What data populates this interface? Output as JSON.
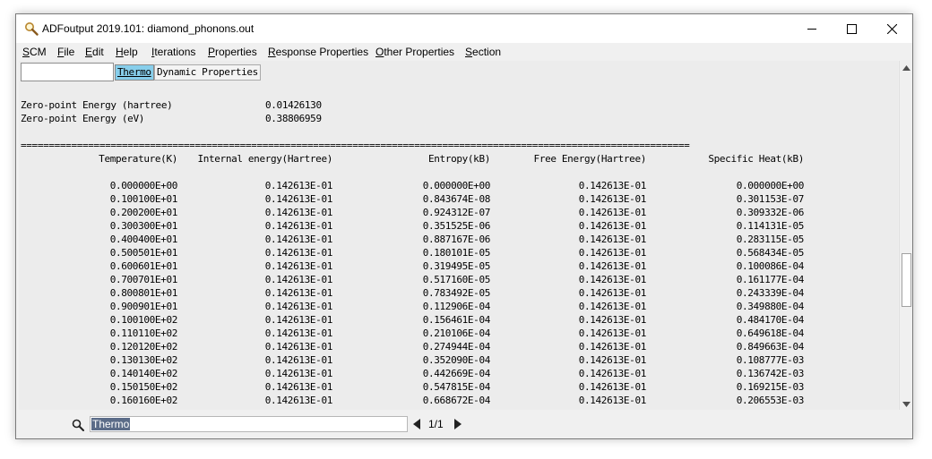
{
  "window": {
    "title": "ADFoutput 2019.101: diamond_phonons.out"
  },
  "menu": [
    {
      "label": "SCM",
      "underline": "S"
    },
    {
      "label": "File",
      "underline": "F"
    },
    {
      "label": "Edit",
      "underline": "E"
    },
    {
      "label": "Help",
      "underline": "H"
    },
    {
      "label": "Iterations",
      "underline": "I"
    },
    {
      "label": "Properties",
      "underline": "P"
    },
    {
      "label": "Response Properties",
      "underline": "R"
    },
    {
      "label": "Other Properties",
      "underline": "O"
    },
    {
      "label": "Section",
      "underline": "S"
    }
  ],
  "tabs": {
    "thermo": "Thermo",
    "dynamic": "Dynamic Properties"
  },
  "zpe": [
    {
      "label": "Zero-point Energy (hartree)",
      "value": "0.01426130"
    },
    {
      "label": "Zero-point Energy (eV)",
      "value": "0.38806959"
    }
  ],
  "separator": "=======================================================================================================================",
  "table": {
    "headers": [
      "Temperature(K)",
      "Internal energy(Hartree)",
      "Entropy(kB)",
      "Free Energy(Hartree)",
      "Specific Heat(kB)"
    ],
    "rows": [
      [
        "0.000000E+00",
        "0.142613E-01",
        "0.000000E+00",
        "0.142613E-01",
        "0.000000E+00"
      ],
      [
        "0.100100E+01",
        "0.142613E-01",
        "0.843674E-08",
        "0.142613E-01",
        "0.301153E-07"
      ],
      [
        "0.200200E+01",
        "0.142613E-01",
        "0.924312E-07",
        "0.142613E-01",
        "0.309332E-06"
      ],
      [
        "0.300300E+01",
        "0.142613E-01",
        "0.351525E-06",
        "0.142613E-01",
        "0.114131E-05"
      ],
      [
        "0.400400E+01",
        "0.142613E-01",
        "0.887167E-06",
        "0.142613E-01",
        "0.283115E-05"
      ],
      [
        "0.500501E+01",
        "0.142613E-01",
        "0.180101E-05",
        "0.142613E-01",
        "0.568434E-05"
      ],
      [
        "0.600601E+01",
        "0.142613E-01",
        "0.319495E-05",
        "0.142613E-01",
        "0.100086E-04"
      ],
      [
        "0.700701E+01",
        "0.142613E-01",
        "0.517160E-05",
        "0.142613E-01",
        "0.161177E-04"
      ],
      [
        "0.800801E+01",
        "0.142613E-01",
        "0.783492E-05",
        "0.142613E-01",
        "0.243339E-04"
      ],
      [
        "0.900901E+01",
        "0.142613E-01",
        "0.112906E-04",
        "0.142613E-01",
        "0.349880E-04"
      ],
      [
        "0.100100E+02",
        "0.142613E-01",
        "0.156461E-04",
        "0.142613E-01",
        "0.484170E-04"
      ],
      [
        "0.110110E+02",
        "0.142613E-01",
        "0.210106E-04",
        "0.142613E-01",
        "0.649618E-04"
      ],
      [
        "0.120120E+02",
        "0.142613E-01",
        "0.274944E-04",
        "0.142613E-01",
        "0.849663E-04"
      ],
      [
        "0.130130E+02",
        "0.142613E-01",
        "0.352090E-04",
        "0.142613E-01",
        "0.108777E-03"
      ],
      [
        "0.140140E+02",
        "0.142613E-01",
        "0.442669E-04",
        "0.142613E-01",
        "0.136742E-03"
      ],
      [
        "0.150150E+02",
        "0.142613E-01",
        "0.547815E-04",
        "0.142613E-01",
        "0.169215E-03"
      ],
      [
        "0.160160E+02",
        "0.142613E-01",
        "0.668672E-04",
        "0.142613E-01",
        "0.206553E-03"
      ]
    ]
  },
  "find": {
    "value": "Thermo",
    "page_indicator": "1/1"
  },
  "colors": {
    "tab_highlight": "#87ceeb",
    "selection": "#5b6c88",
    "content_bg": "#ececec"
  },
  "icons": {
    "app": "magnifier-app-icon",
    "minimize": "minimize-icon",
    "maximize": "maximize-icon",
    "close": "close-icon",
    "search": "search-icon",
    "prev": "triangle-left-icon",
    "next": "triangle-right-icon"
  }
}
